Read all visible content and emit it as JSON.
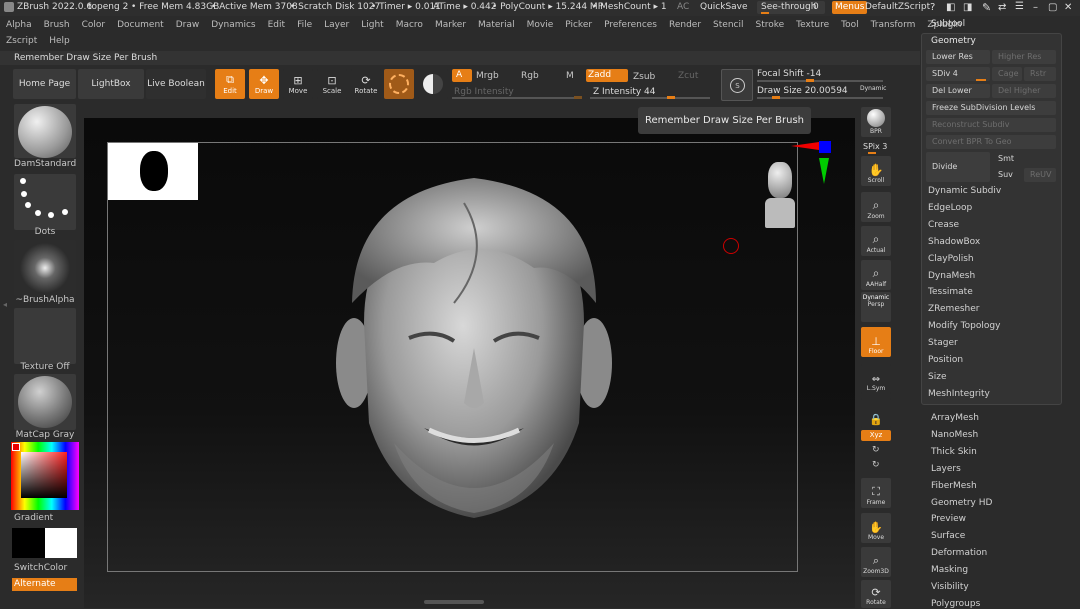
{
  "titlebar": {
    "app": "ZBrush 2022.0.6",
    "doc": "topeng 2",
    "free_mem": "• Free Mem 4.83GB",
    "active_mem": "• Active Mem 3708",
    "scratch": "• Scratch Disk 1027",
    "timer": "• Timer ▸ 0.011",
    "atime": "ATime ▸ 0.442",
    "polycount": "• PolyCount ▸ 15.244 MP",
    "meshcount": "• MeshCount ▸ 1",
    "ac": "AC",
    "quicksave": "QuickSave",
    "see_through": "See-through",
    "see_through_value": "0",
    "menus": "Menus",
    "default_zscript": "DefaultZScript"
  },
  "menus": [
    "Alpha",
    "Brush",
    "Color",
    "Document",
    "Draw",
    "Dynamics",
    "Edit",
    "File",
    "Layer",
    "Light",
    "Macro",
    "Marker",
    "Material",
    "Movie",
    "Picker",
    "Preferences",
    "Render",
    "Stencil",
    "Stroke",
    "Texture",
    "Tool",
    "Transform",
    "Zplugin"
  ],
  "menus2": [
    "Zscript",
    "Help"
  ],
  "subtitle": "Remember Draw Size Per Brush",
  "toolbar": {
    "home": "Home Page",
    "lightbox": "LightBox",
    "live_boolean": "Live Boolean",
    "edit": "Edit",
    "draw": "Draw",
    "move": "Move",
    "scale": "Scale",
    "rotate": "Rotate",
    "a": "A",
    "mrgb": "Mrgb",
    "rgb": "Rgb",
    "m": "M",
    "zadd": "Zadd",
    "zsub": "Zsub",
    "zcut": "Zcut",
    "rgb_intensity": "Rgb Intensity",
    "z_intensity": "Z Intensity 44",
    "focal_shift": "Focal Shift -14",
    "draw_size": "Draw Size 20.00594",
    "dynamic": "Dynamic"
  },
  "left": {
    "brush": "DamStandard",
    "stroke": "Dots",
    "alpha": "~BrushAlpha",
    "texture": "Texture Off",
    "material": "MatCap Gray",
    "gradient": "Gradient",
    "switch_color": "SwitchColor",
    "alternate": "Alternate"
  },
  "shelf": {
    "bpr": "BPR",
    "spix": "SPix 3",
    "scroll": "Scroll",
    "zoom": "Zoom",
    "actual": "Actual",
    "aahalf": "AAHalf",
    "dynamic": "Dynamic",
    "persp": "Persp",
    "floor": "Floor",
    "lsym": "L.Sym",
    "xyz": "Xyz",
    "frame": "Frame",
    "move": "Move",
    "zoom3d": "Zoom3D",
    "rotate": "Rotate"
  },
  "tooltip": "Remember Draw Size Per Brush",
  "geometry": {
    "subtool": "Subtool",
    "title": "Geometry",
    "lower_res": "Lower Res",
    "higher_res": "Higher Res",
    "sdiv": "SDiv 4",
    "cage": "Cage",
    "rstr": "Rstr",
    "del_lower": "Del Lower",
    "del_higher": "Del Higher",
    "freeze": "Freeze SubDivision Levels",
    "reconstruct": "Reconstruct Subdiv",
    "convert_bpr": "Convert BPR To Geo",
    "divide": "Divide",
    "smt": "Smt",
    "suv": "Suv",
    "reuv": "ReUV",
    "items": [
      "Dynamic Subdiv",
      "EdgeLoop",
      "Crease",
      "ShadowBox",
      "ClayPolish",
      "DynaMesh",
      "Tessimate",
      "ZRemesher",
      "Modify Topology",
      "Stager",
      "Position",
      "Size",
      "MeshIntegrity"
    ]
  },
  "subpanels": [
    "ArrayMesh",
    "NanoMesh",
    "Thick Skin",
    "Layers",
    "FiberMesh",
    "Geometry HD",
    "Preview",
    "Surface",
    "Deformation",
    "Masking",
    "Visibility",
    "Polygroups"
  ],
  "colors": {
    "accent": "#e67e16",
    "panel": "#333333",
    "bg": "#2b2b2b"
  }
}
